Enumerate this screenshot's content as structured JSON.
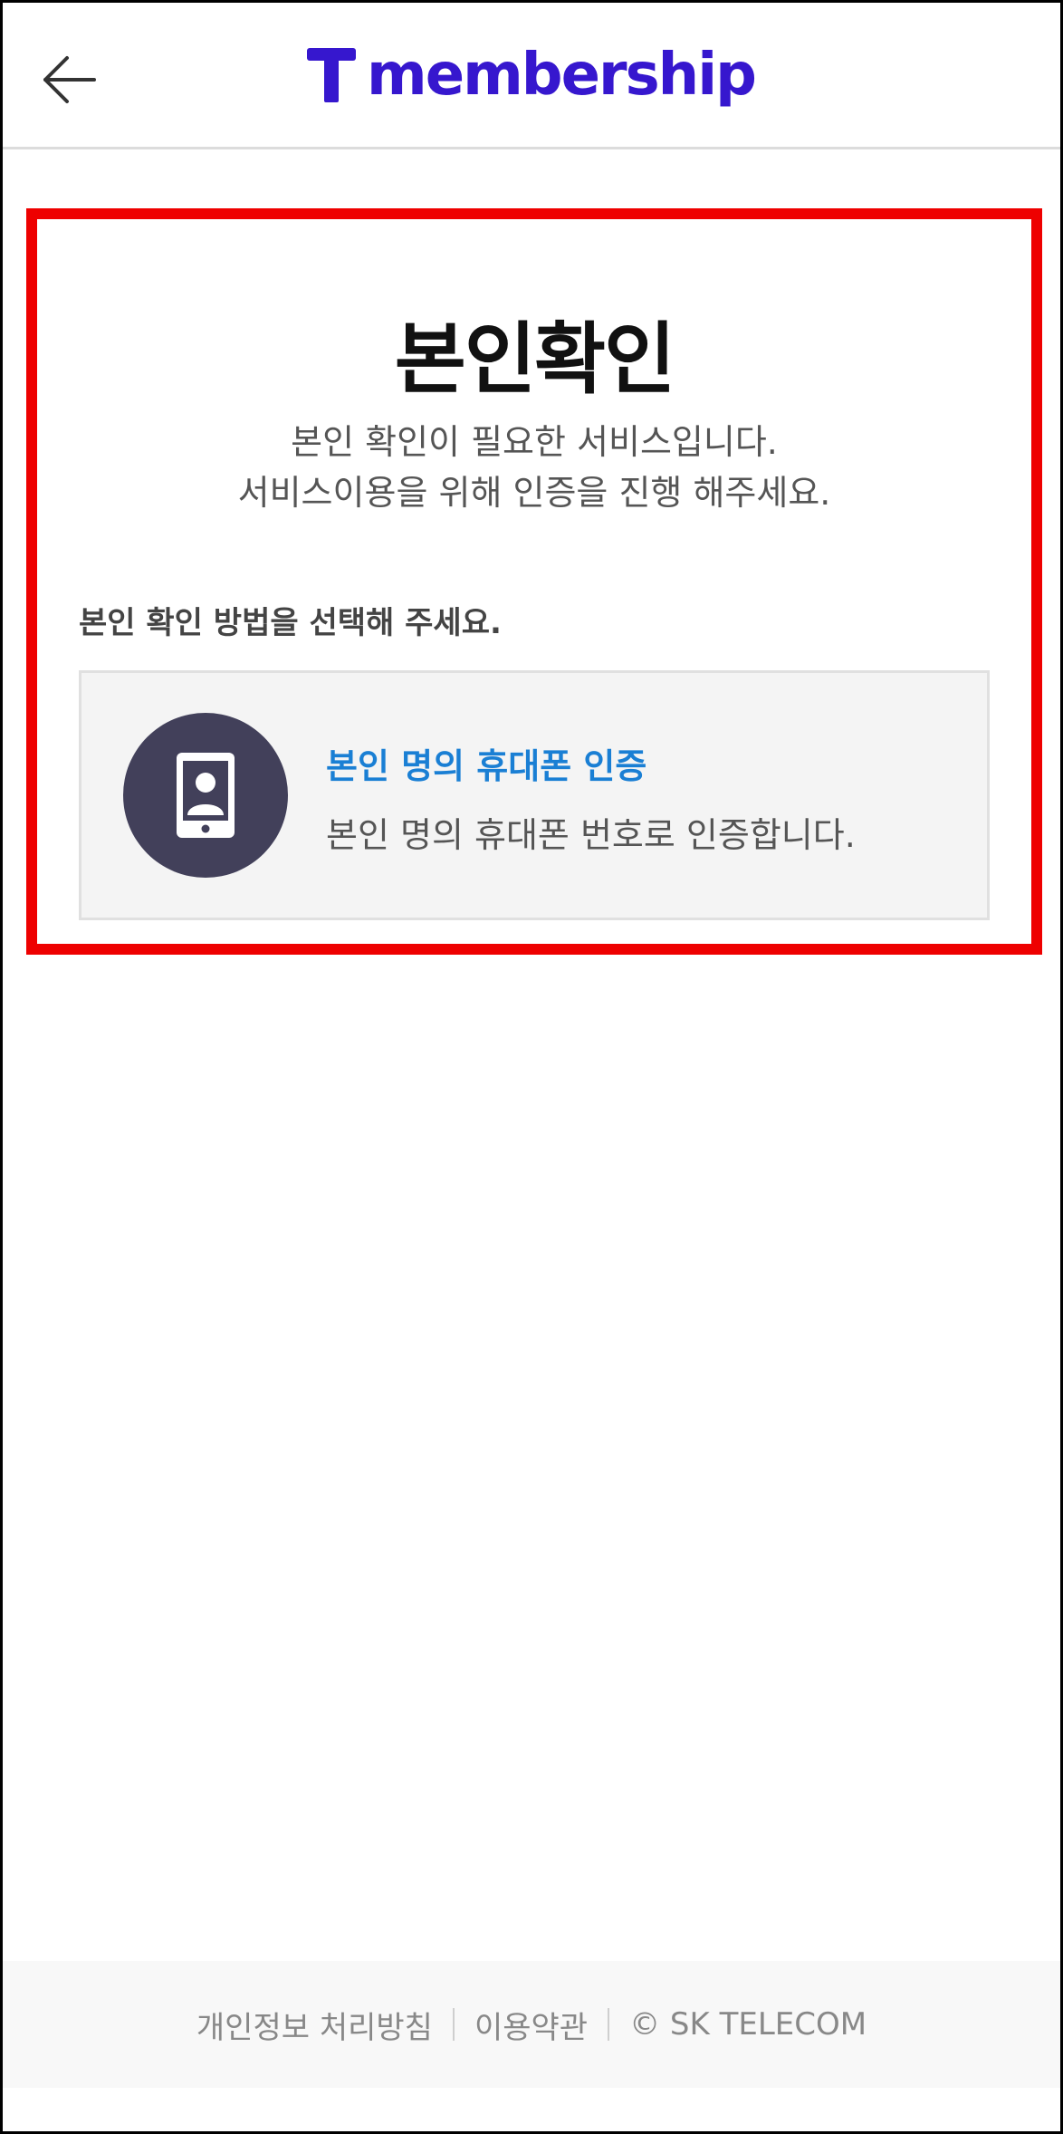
{
  "header": {
    "logo_text": "membership",
    "brand_color": "#3617CE",
    "back_icon": "arrow-left-icon"
  },
  "main": {
    "title": "본인확인",
    "desc_line1": "본인 확인이 필요한 서비스입니다.",
    "desc_line2": "서비스이용을 위해 인증을 진행 해주세요.",
    "section_label": "본인 확인 방법을 선택해 주세요.",
    "option": {
      "icon": "phone-user-icon",
      "title": "본인 명의 휴대폰 인증",
      "description": "본인 명의 휴대폰 번호로 인증합니다.",
      "title_color": "#1a7fd4"
    }
  },
  "footer": {
    "privacy": "개인정보 처리방침",
    "terms": "이용약관",
    "copyright": "© SK TELECOM"
  },
  "highlight_color": "#ee0000"
}
